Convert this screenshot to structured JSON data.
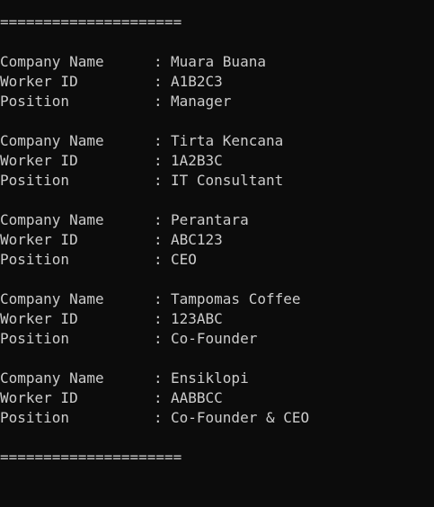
{
  "terminal": {
    "background": "#0c0c0c",
    "foreground": "#cccccc",
    "separator": "=====================",
    "labels": {
      "company": "Company Name",
      "worker": "Worker ID",
      "position": "Position",
      "colon": ":"
    },
    "records": [
      {
        "company": "Muara Buana",
        "worker_id": "A1B2C3",
        "position": "Manager"
      },
      {
        "company": "Tirta Kencana",
        "worker_id": "1A2B3C",
        "position": "IT Consultant"
      },
      {
        "company": "Perantara",
        "worker_id": "ABC123",
        "position": "CEO"
      },
      {
        "company": "Tampomas Coffee",
        "worker_id": "123ABC",
        "position": "Co-Founder"
      },
      {
        "company": "Ensiklopi",
        "worker_id": "AABBCC",
        "position": "Co-Founder & CEO"
      }
    ]
  }
}
